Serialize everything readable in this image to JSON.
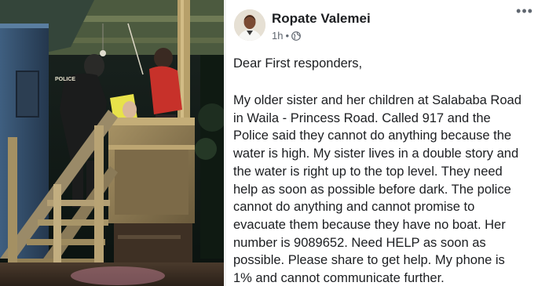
{
  "post": {
    "author": "Ropate Valemei",
    "time": "1h",
    "separator": "•",
    "privacy_icon": "globe-icon",
    "more_icon": "more-options-icon",
    "greeting": "Dear First responders,",
    "body_lines": [
      "My older sister and her children at Salababa Road",
      "in Waila - Princess Road. Called 917 and the",
      "Police said they cannot do anything because the",
      "water is high. My sister lives in a double story and",
      "the water is right up to the  top level. They need",
      "help as soon as possible before dark. The police",
      "cannot do anything and cannot promise to",
      "evacuate them because they have no boat. Her",
      "number is 9089652. Need HELP as soon as",
      "possible. Please share to get help. My phone is",
      "1% and cannot communicate further."
    ]
  },
  "photo": {
    "vest_label": "POLICE"
  },
  "colors": {
    "text": "#1c1e21",
    "meta": "#606770",
    "background": "#ffffff"
  }
}
